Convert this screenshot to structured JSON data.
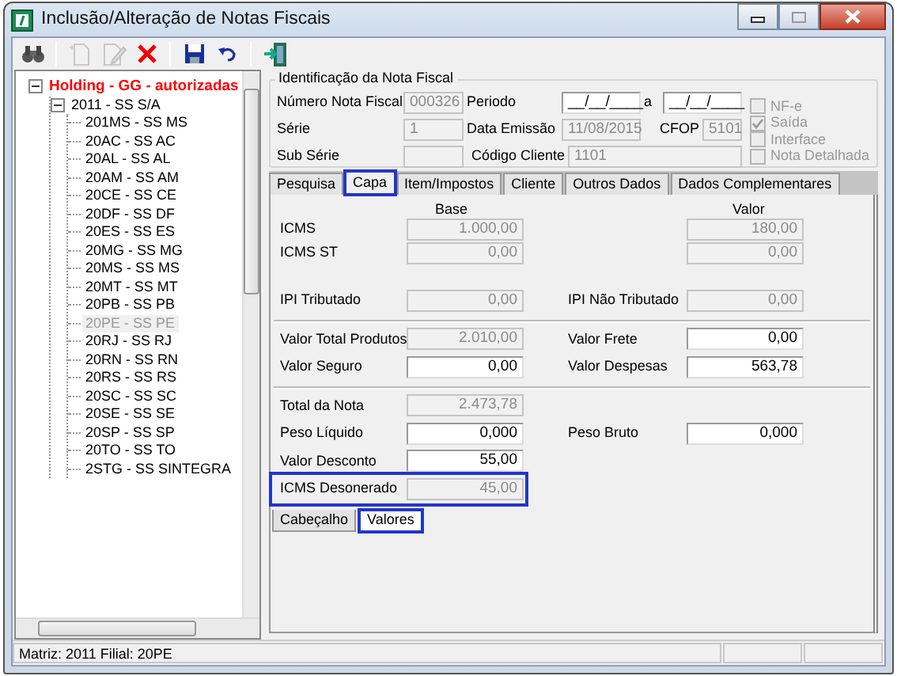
{
  "window": {
    "title": "Inclusão/Alteração de Notas Fiscais"
  },
  "toolbar": [
    {
      "kind": "find",
      "disabled": false
    },
    {
      "kind": "separator"
    },
    {
      "kind": "new",
      "disabled": true
    },
    {
      "kind": "edit",
      "disabled": true
    },
    {
      "kind": "delete",
      "disabled": false
    },
    {
      "kind": "separator"
    },
    {
      "kind": "save",
      "disabled": false
    },
    {
      "kind": "undo",
      "disabled": false
    },
    {
      "kind": "separator"
    },
    {
      "kind": "exit",
      "disabled": false
    }
  ],
  "tree": [
    {
      "label": "Holding -  GG -  autorizadas",
      "kind": "holding",
      "expanded": true,
      "selected": false,
      "children": [
        {
          "label": "2011 - SS S/A",
          "expanded": true,
          "selected": false,
          "children": [
            {
              "label": "201MS - SS MS",
              "selected": false
            },
            {
              "label": "20AC - SS AC",
              "selected": false
            },
            {
              "label": "20AL - SS AL",
              "selected": false
            },
            {
              "label": "20AM - SS AM",
              "selected": false
            },
            {
              "label": "20CE - SS CE",
              "selected": false
            },
            {
              "label": "20DF - SS DF",
              "selected": false
            },
            {
              "label": "20ES - SS ES",
              "selected": false
            },
            {
              "label": "20MG - SS MG",
              "selected": false
            },
            {
              "label": "20MS - SS MS",
              "selected": false
            },
            {
              "label": "20MT - SS MT",
              "selected": false
            },
            {
              "label": "20PB - SS PB",
              "selected": false
            },
            {
              "label": "20PE - SS PE",
              "selected": true
            },
            {
              "label": "20RJ - SS RJ",
              "selected": false
            },
            {
              "label": "20RN - SS RN",
              "selected": false
            },
            {
              "label": "20RS - SS RS",
              "selected": false
            },
            {
              "label": "20SC - SS SC",
              "selected": false
            },
            {
              "label": "20SE - SS SE",
              "selected": false
            },
            {
              "label": "20SP - SS SP",
              "selected": false
            },
            {
              "label": "20TO - SS TO",
              "selected": false
            },
            {
              "label": "2STG - SS SINTEGRA",
              "selected": false
            }
          ]
        }
      ]
    }
  ],
  "identification": {
    "title": "Identificação da Nota Fiscal",
    "rows": [
      [
        {
          "label": "Número Nota Fiscal",
          "value": "000326",
          "disabled": true
        },
        {
          "label": "Periodo",
          "value": "__/__/____",
          "disabled": false
        },
        {
          "label": "a",
          "value": "__/__/____",
          "disabled": false
        }
      ],
      [
        {
          "label": "Série",
          "value": "1",
          "disabled": true
        },
        {
          "label": "Data Emissão",
          "value": "11/08/2015",
          "disabled": true
        },
        {
          "label": "CFOP",
          "value": "5101",
          "disabled": true
        }
      ],
      [
        {
          "label": "Sub Série",
          "disabled": true
        },
        {
          "label": "Código Cliente",
          "value": "1101",
          "disabled": true
        }
      ]
    ],
    "checkboxes": [
      {
        "label": "NF-e",
        "checked": false,
        "disabled": true
      },
      {
        "label": "Saída",
        "checked": true,
        "disabled": true
      },
      {
        "label": "Interface",
        "checked": false,
        "disabled": true
      },
      {
        "label": "Nota Detalhada",
        "checked": false,
        "disabled": true
      }
    ]
  },
  "tabs": [
    {
      "label": "Pesquisa",
      "selected": false,
      "highlighted": false
    },
    {
      "label": "Capa",
      "selected": true,
      "highlighted": true
    },
    {
      "label": "Item/Impostos",
      "selected": false,
      "highlighted": false
    },
    {
      "label": "Cliente",
      "selected": false,
      "highlighted": false
    },
    {
      "label": "Outros Dados",
      "selected": false,
      "highlighted": false
    },
    {
      "label": "Dados Complementares",
      "selected": false,
      "highlighted": false
    }
  ],
  "capa": {
    "columns": [
      "Base",
      "Valor"
    ],
    "sections": [
      {
        "rows": [
          {
            "highlighted": false,
            "left": {
              "label": "ICMS",
              "value": "1.000,00",
              "disabled": true
            },
            "right": {
              "value": "180,00",
              "disabled": true
            }
          },
          {
            "highlighted": false,
            "left": {
              "label": "ICMS ST",
              "value": "0,00",
              "disabled": true
            },
            "right": {
              "value": "0,00",
              "disabled": true
            }
          },
          {
            "highlighted": false,
            "left": {
              "label": "IPI Tributado",
              "value": "0,00",
              "disabled": true
            },
            "right": {
              "label": "IPI Não Tributado",
              "value": "0,00",
              "disabled": true
            }
          }
        ]
      },
      {
        "rows": [
          {
            "highlighted": false,
            "left": {
              "label": "Valor Total Produtos",
              "value": "2.010,00",
              "disabled": true
            },
            "right": {
              "label": "Valor Frete",
              "value": "0,00",
              "disabled": false
            }
          },
          {
            "highlighted": false,
            "left": {
              "label": "Valor Seguro",
              "value": "0,00",
              "disabled": false
            },
            "right": {
              "label": "Valor Despesas",
              "value": "563,78",
              "disabled": false
            }
          }
        ]
      },
      {
        "rows": [
          {
            "highlighted": false,
            "left": {
              "label": "Total da Nota",
              "value": "2.473,78",
              "disabled": true
            }
          },
          {
            "highlighted": false,
            "left": {
              "label": "Peso Líquido",
              "value": "0,000",
              "disabled": false
            },
            "right": {
              "label": "Peso Bruto",
              "value": "0,000",
              "disabled": false
            }
          },
          {
            "highlighted": false,
            "left": {
              "label": "Valor Desconto",
              "value": "55,00",
              "disabled": false
            }
          },
          {
            "highlighted": true,
            "left": {
              "label": "ICMS Desonerado",
              "value": "45,00",
              "disabled": true
            }
          }
        ]
      }
    ]
  },
  "bottom_tabs": [
    {
      "label": "Cabeçalho",
      "selected": false,
      "highlighted": false
    },
    {
      "label": "Valores",
      "selected": true,
      "highlighted": true
    }
  ],
  "status_bar": {
    "text": "Matriz: 2011 Filial: 20PE"
  }
}
